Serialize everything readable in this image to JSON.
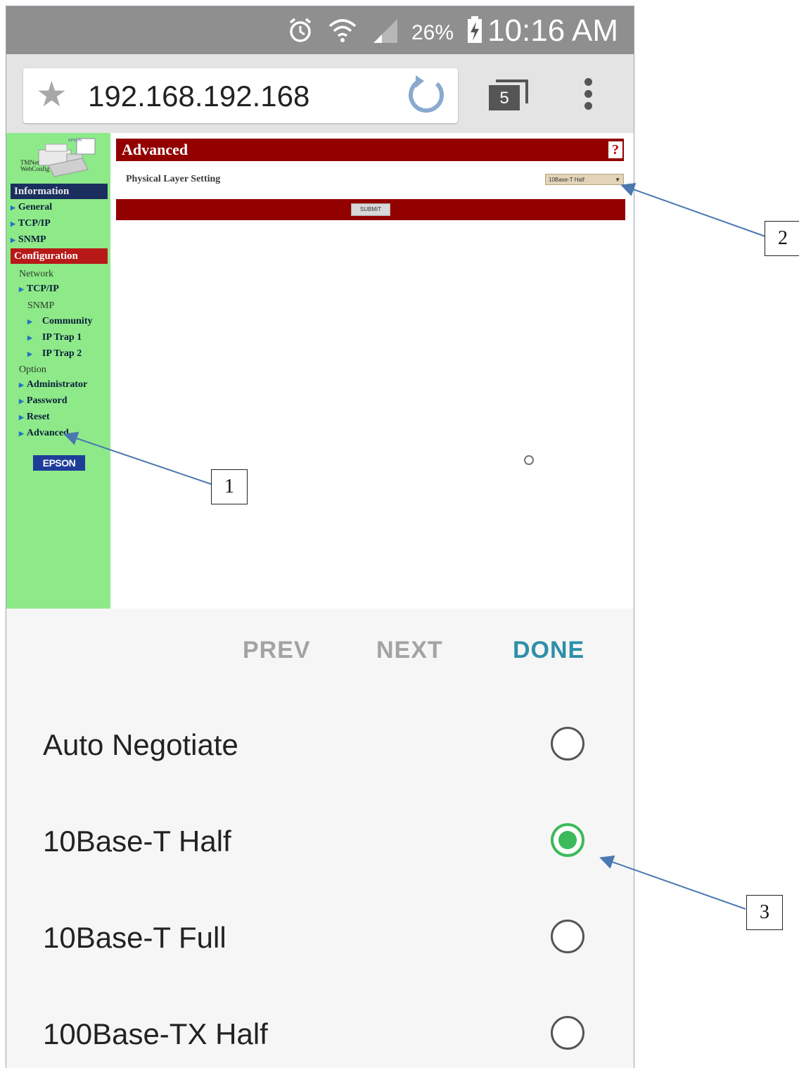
{
  "status_bar": {
    "battery": "26%",
    "time": "10:16 AM",
    "icons": [
      "alarm-icon",
      "wifi-icon",
      "signal-icon",
      "battery-charging-icon"
    ]
  },
  "browser": {
    "url": "192.168.192.168",
    "tab_count": "5",
    "icons": [
      "star-icon",
      "reload-icon",
      "tabs-icon",
      "overflow-menu-icon"
    ]
  },
  "sidebar": {
    "logo_caption": "TMNet WebConfig",
    "logo_brand": "EPSON",
    "information_header": "Information",
    "information_items": [
      "General",
      "TCP/IP",
      "SNMP"
    ],
    "configuration_header": "Configuration",
    "network_label": "Network",
    "network_tcpip": "TCP/IP",
    "snmp_label": "SNMP",
    "snmp_items": [
      "Community",
      "IP Trap 1",
      "IP Trap 2"
    ],
    "option_label": "Option",
    "option_items": [
      "Administrator",
      "Password",
      "Reset",
      "Advanced"
    ],
    "brand_badge": "EPSON"
  },
  "main": {
    "title": "Advanced",
    "help": "?",
    "physical_layer_label": "Physical Layer Setting",
    "physical_layer_value": "10Base-T Half",
    "submit_label": "SUBMIT"
  },
  "accessory": {
    "prev": "PREV",
    "next": "NEXT",
    "done": "DONE"
  },
  "options": [
    {
      "label": "Auto Negotiate",
      "selected": false
    },
    {
      "label": "10Base-T Half",
      "selected": true
    },
    {
      "label": "10Base-T Full",
      "selected": false
    },
    {
      "label": "100Base-TX Half",
      "selected": false
    }
  ],
  "callouts": [
    "1",
    "2",
    "3"
  ],
  "colors": {
    "sidebar_bg": "#8ee989",
    "header_red": "#930000",
    "radio_selected": "#3dba5c",
    "done_accent": "#2e8fa8",
    "annotation_line": "#4a78b0"
  }
}
